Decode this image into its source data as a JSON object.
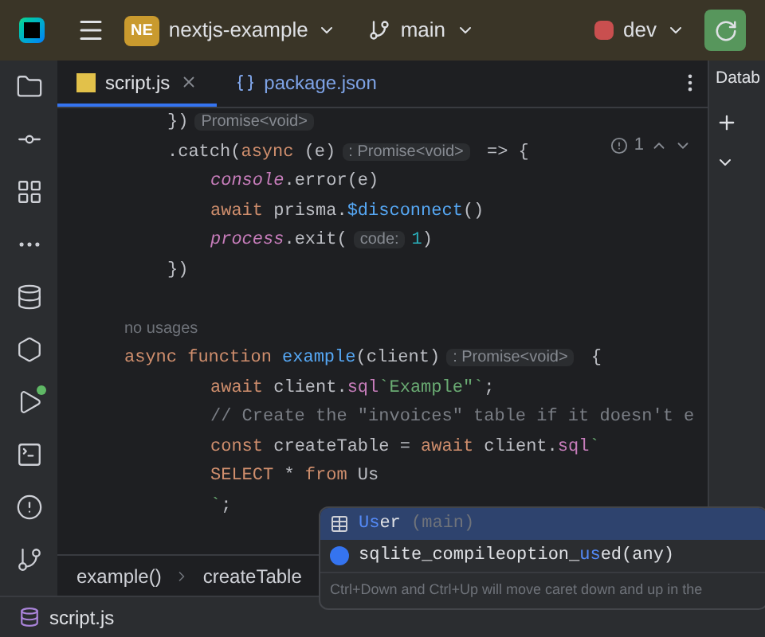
{
  "toolbar": {
    "project_badge": "NE",
    "project": "nextjs-example",
    "branch": "main",
    "run_config": "dev"
  },
  "tabs": [
    {
      "label": "script.js",
      "kind": "js",
      "selected": true
    },
    {
      "label": "package.json",
      "kind": "json",
      "selected": false
    }
  ],
  "side_panel": {
    "title": "Datab"
  },
  "problems": {
    "count": "1"
  },
  "code_lines": [
    {
      "kind": "half",
      "tokens": [
        {
          "kind": "plain",
          "t": "})"
        },
        {
          "kind": "hint",
          "t": "Promise<void>"
        }
      ]
    },
    {
      "kind": "half",
      "tokens": [
        {
          "kind": "plain",
          "t": ".catch("
        },
        {
          "kind": "kw",
          "t": "async"
        },
        {
          "kind": "plain",
          "t": " (e)"
        },
        {
          "kind": "hint",
          "t": ": Promise<void>"
        },
        {
          "kind": "plain",
          "t": " => {"
        }
      ]
    },
    {
      "kind": "inner",
      "tokens": [
        {
          "kind": "italic",
          "t": "console"
        },
        {
          "kind": "plain",
          "t": ".error(e)"
        }
      ]
    },
    {
      "kind": "inner",
      "tokens": [
        {
          "kind": "kw",
          "t": "await"
        },
        {
          "kind": "plain",
          "t": " prisma."
        },
        {
          "kind": "fn",
          "t": "$disconnect"
        },
        {
          "kind": "plain",
          "t": "()"
        }
      ]
    },
    {
      "kind": "inner",
      "tokens": [
        {
          "kind": "italic",
          "t": "process"
        },
        {
          "kind": "plain",
          "t": ".exit("
        },
        {
          "kind": "hint",
          "t": "code:"
        },
        {
          "kind": "num",
          "t": "1"
        },
        {
          "kind": "plain",
          "t": ")"
        }
      ]
    },
    {
      "kind": "half",
      "tokens": [
        {
          "kind": "plain",
          "t": "})"
        }
      ]
    },
    {
      "kind": "blank"
    },
    {
      "kind": "outer",
      "tokens": [
        {
          "kind": "usage",
          "t": "no usages"
        }
      ]
    },
    {
      "kind": "outer",
      "tokens": [
        {
          "kind": "kw",
          "t": "async function "
        },
        {
          "kind": "fn",
          "t": "example"
        },
        {
          "kind": "plain",
          "t": "(client)"
        },
        {
          "kind": "hint",
          "t": ": Promise<void>"
        },
        {
          "kind": "plain",
          "t": " {"
        }
      ]
    },
    {
      "kind": "inner",
      "tokens": [
        {
          "kind": "kw",
          "t": "await"
        },
        {
          "kind": "plain",
          "t": " client."
        },
        {
          "kind": "prop",
          "t": "sql"
        },
        {
          "kind": "str",
          "t": "`Example\"`"
        },
        {
          "kind": "plain",
          "t": ";"
        }
      ]
    },
    {
      "kind": "inner",
      "tokens": [
        {
          "kind": "comment",
          "t": "// Create the \"invoices\" table if it doesn't e"
        }
      ]
    },
    {
      "kind": "inner",
      "tokens": [
        {
          "kind": "kw",
          "t": "const"
        },
        {
          "kind": "plain",
          "t": " createTable = "
        },
        {
          "kind": "kw",
          "t": "await"
        },
        {
          "kind": "plain",
          "t": " client."
        },
        {
          "kind": "prop",
          "t": "sql"
        },
        {
          "kind": "str",
          "t": "`"
        }
      ]
    },
    {
      "kind": "inner",
      "tokens": [
        {
          "kind": "kw",
          "t": "SELECT"
        },
        {
          "kind": "plain",
          "t": " * "
        },
        {
          "kind": "kw",
          "t": "from"
        },
        {
          "kind": "plain",
          "t": " Us"
        }
      ]
    },
    {
      "kind": "inner",
      "tokens": [
        {
          "kind": "str",
          "t": "`"
        },
        {
          "kind": "plain",
          "t": ";"
        }
      ]
    }
  ],
  "completion": {
    "items": [
      {
        "kind": "table",
        "selected": true,
        "parts": [
          {
            "t": "Us",
            "match": true
          },
          {
            "t": "er",
            "match": false
          }
        ],
        "detail": "(main)"
      },
      {
        "kind": "function",
        "selected": false,
        "parts": [
          {
            "t": "sqlite_compileoption_",
            "match": false
          },
          {
            "t": "us",
            "match": true
          },
          {
            "t": "ed(any)",
            "match": false
          }
        ]
      }
    ],
    "hint": "Ctrl+Down and Ctrl+Up will move caret down and up in the"
  },
  "breadcrumbs": [
    "example()",
    "createTable"
  ],
  "status_bar": {
    "file": "script.js"
  }
}
